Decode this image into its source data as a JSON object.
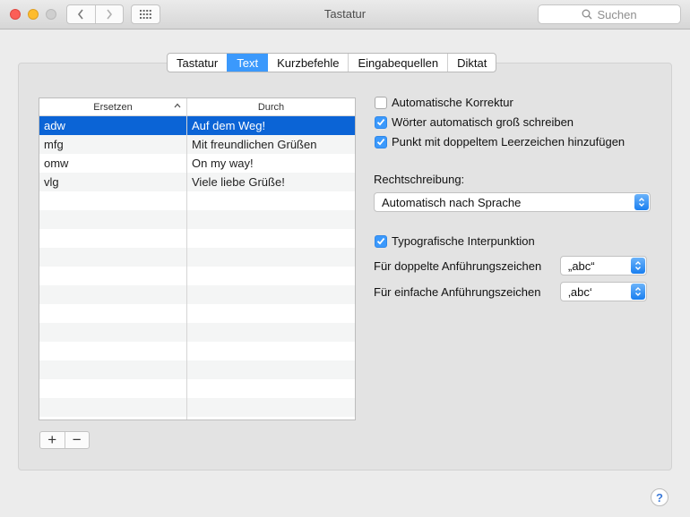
{
  "window": {
    "title": "Tastatur"
  },
  "toolbar": {
    "search_placeholder": "Suchen"
  },
  "tabs": [
    {
      "label": "Tastatur"
    },
    {
      "label": "Text"
    },
    {
      "label": "Kurzbefehle"
    },
    {
      "label": "Eingabequellen"
    },
    {
      "label": "Diktat"
    }
  ],
  "active_tab": "Text",
  "table": {
    "columns": {
      "replace": "Ersetzen",
      "with": "Durch"
    },
    "rows": [
      {
        "replace": "adw",
        "with": "Auf dem Weg!"
      },
      {
        "replace": "mfg",
        "with": "Mit freundlichen Grüßen"
      },
      {
        "replace": "omw",
        "with": "On my way!"
      },
      {
        "replace": "vlg",
        "with": "Viele liebe Grüße!"
      }
    ],
    "selected_index": 0
  },
  "list_controls": {
    "add": "+",
    "remove": "−"
  },
  "options": {
    "auto_correct": {
      "label": "Automatische Korrektur",
      "checked": false
    },
    "auto_capitalize": {
      "label": "Wörter automatisch groß schreiben",
      "checked": true
    },
    "double_space_period": {
      "label": "Punkt mit doppeltem Leerzeichen hinzufügen",
      "checked": true
    },
    "spelling_label": "Rechtschreibung:",
    "spelling_value": "Automatisch nach Sprache",
    "smart_punct": {
      "label": "Typografische Interpunktion",
      "checked": true
    },
    "double_quotes_label": "Für doppelte Anführungszeichen",
    "double_quotes_value": "„abc“",
    "single_quotes_label": "Für einfache Anführungszeichen",
    "single_quotes_value": "‚abc‘"
  },
  "help": "?",
  "colors": {
    "accent": "#3b99fc",
    "selection": "#0b64d6"
  }
}
